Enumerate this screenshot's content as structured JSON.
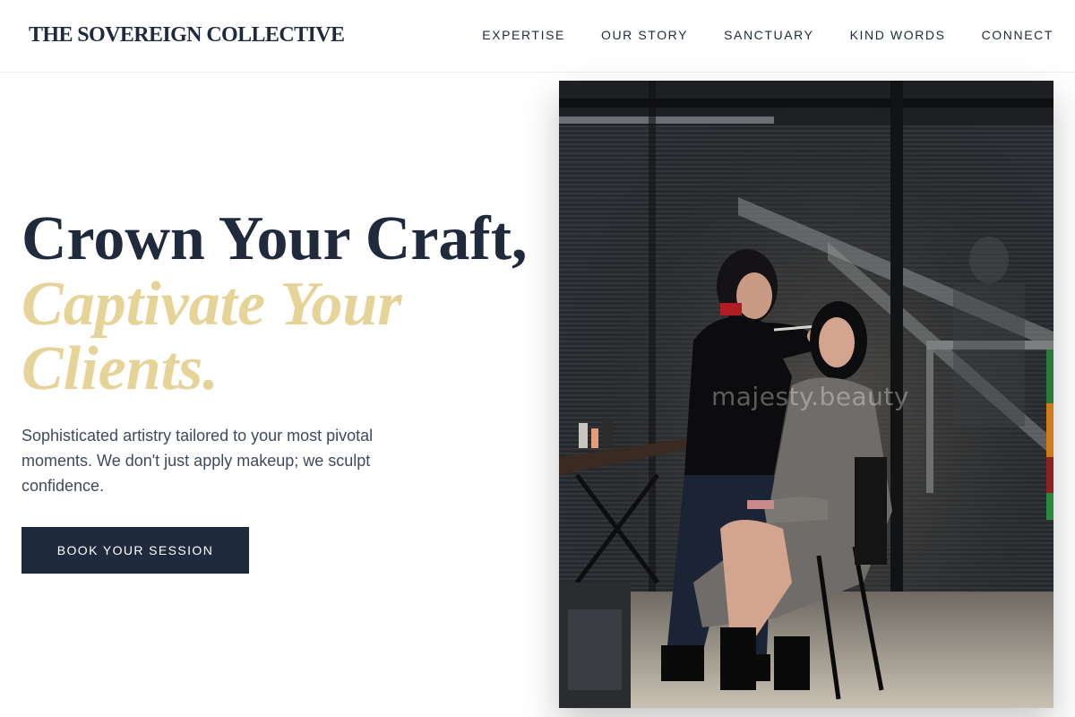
{
  "header": {
    "brand": "THE SOVEREIGN COLLECTIVE",
    "nav": [
      "EXPERTISE",
      "OUR STORY",
      "SANCTUARY",
      "KIND WORDS",
      "CONNECT"
    ]
  },
  "hero": {
    "headline_line1": "Crown Your Craft,",
    "headline_line2": "Captivate Your Clients.",
    "subtext": "Sophisticated artistry tailored to your most pivotal moments. We don't just apply makeup; we sculpt confidence.",
    "cta_label": "BOOK YOUR SESSION"
  },
  "image": {
    "watermark": "majesty.beauty",
    "subject": "makeup artist applying makeup to seated client backstage"
  },
  "colors": {
    "navy": "#1f2a3d",
    "gold": "#e6d398",
    "body_text": "#3f4a5c"
  }
}
